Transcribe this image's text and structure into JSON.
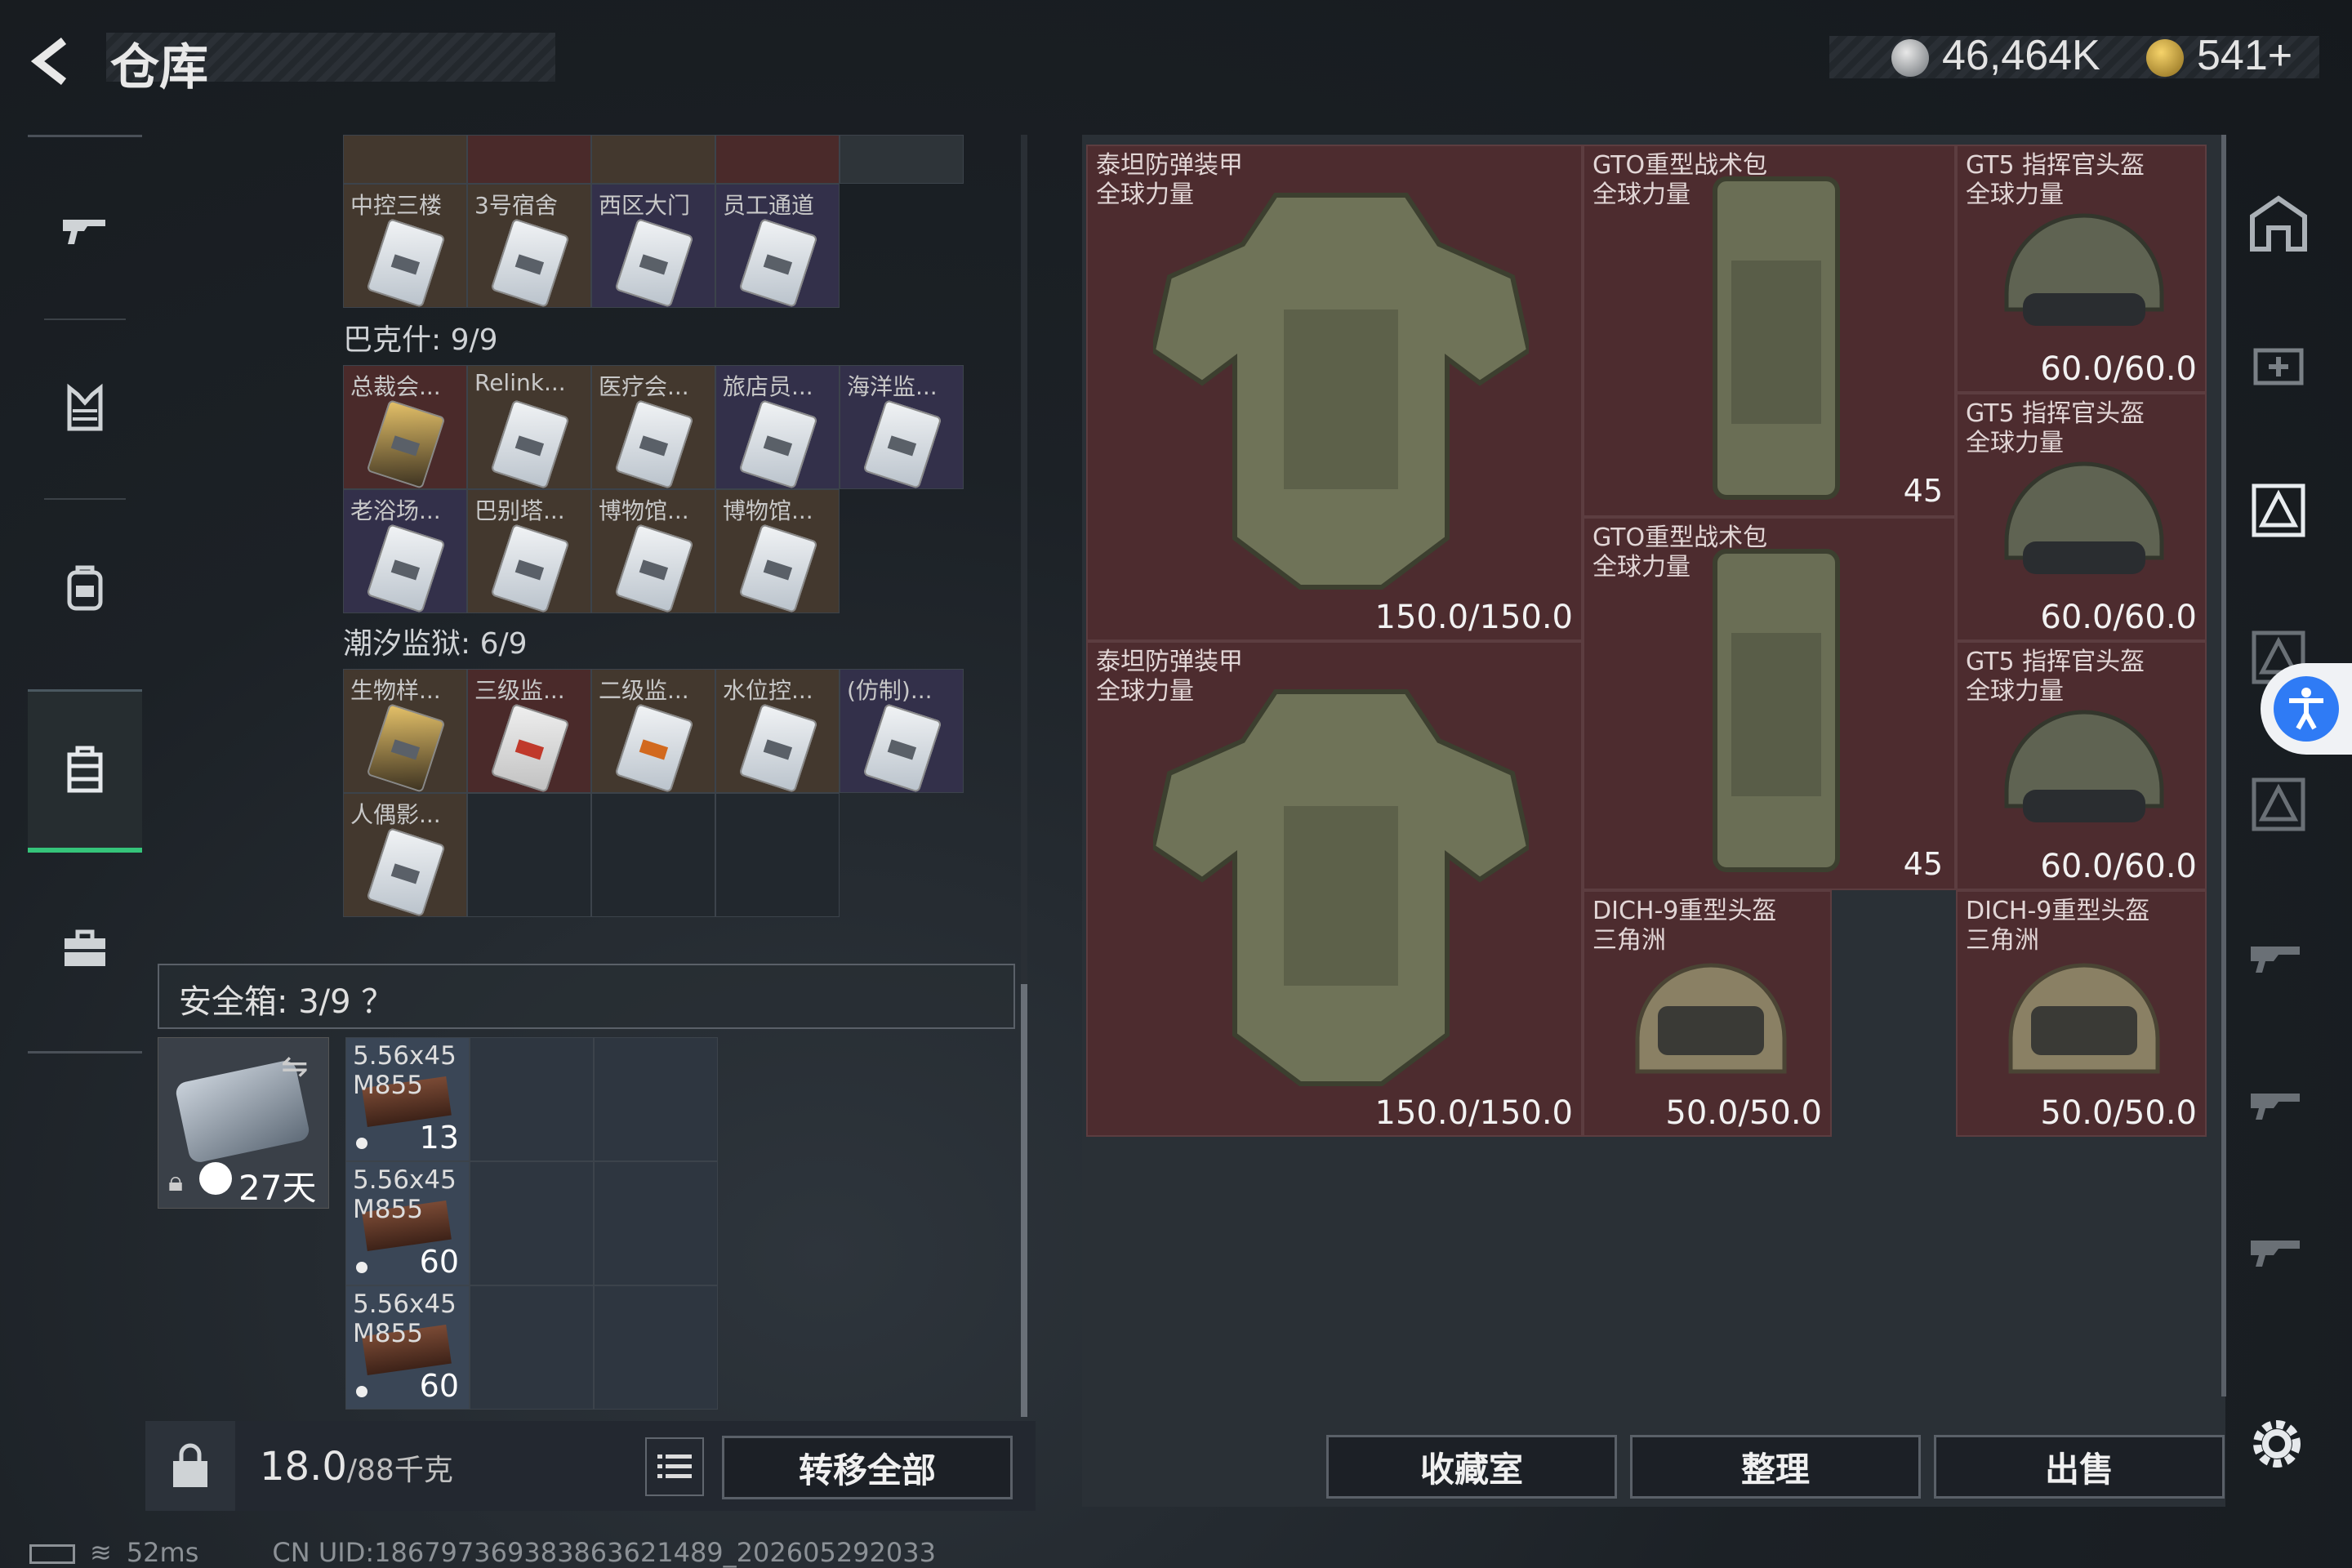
{
  "header": {
    "title": "仓库",
    "back_icon": "back-arrow-icon",
    "currency_silver": "46,464K",
    "currency_gold": "541+"
  },
  "nav": {
    "items": [
      {
        "name": "weapon",
        "icon": "gun-icon"
      },
      {
        "name": "armor",
        "icon": "vest-icon"
      },
      {
        "name": "backpack",
        "icon": "backpack-icon"
      },
      {
        "name": "warehouse",
        "icon": "container-icon",
        "active": true
      },
      {
        "name": "toolbox",
        "icon": "briefcase-icon"
      }
    ]
  },
  "keys": {
    "top_row": [
      "中控三楼",
      "3号宿舍",
      "西区大门",
      "员工通道"
    ],
    "section_bakesh": "巴克什: 9/9",
    "bakesh": [
      "总裁会...",
      "Relink...",
      "医疗会...",
      "旅店员...",
      "海洋监...",
      "老浴场...",
      "巴别塔...",
      "博物馆...",
      "博物馆..."
    ],
    "section_tide": "潮汐监狱: 6/9",
    "tide": [
      "生物样...",
      "三级监...",
      "二级监...",
      "水位控...",
      "(仿制)...",
      "人偶影..."
    ]
  },
  "safe": {
    "label": "安全箱: 3/9 ？",
    "timer": "27天",
    "ammo": [
      {
        "name": "5.56x45\nM855",
        "count": "13"
      },
      {
        "name": "5.56x45\nM855",
        "count": "60"
      },
      {
        "name": "5.56x45\nM855",
        "count": "60"
      }
    ]
  },
  "weight": {
    "value": "18.0",
    "max": "/88千克"
  },
  "buttons": {
    "transfer_all": "转移全部",
    "collection": "收藏室",
    "organize": "整理",
    "sell": "出售"
  },
  "items": {
    "vest1": {
      "name": "泰坦防弹装甲\n全球力量",
      "durability": "150.0/150.0"
    },
    "vest2": {
      "name": "泰坦防弹装甲\n全球力量",
      "durability": "150.0/150.0"
    },
    "bag1": {
      "name": "GTO重型战术包\n全球力量",
      "weight": "45"
    },
    "bag2": {
      "name": "GTO重型战术包\n全球力量",
      "weight": "45"
    },
    "helm1": {
      "name": "GT5 指挥官头盔\n全球力量",
      "durability": "60.0/60.0"
    },
    "helm2": {
      "name": "GT5 指挥官头盔\n全球力量",
      "durability": "60.0/60.0"
    },
    "helm3": {
      "name": "GT5 指挥官头盔\n全球力量",
      "durability": "60.0/60.0"
    },
    "dich1": {
      "name": "DICH-9重型头盔\n三角洲",
      "durability": "50.0/50.0"
    },
    "dich2": {
      "name": "DICH-9重型头盔\n三角洲",
      "durability": "50.0/50.0"
    }
  },
  "status": {
    "ping": "52ms",
    "uid": "CN UID:18679736938386362148​9_202605292033"
  },
  "colors": {
    "accent_green": "#35c47a",
    "item_bg": "#4a2b2e",
    "accessibility_blue": "#2f7bf5"
  }
}
